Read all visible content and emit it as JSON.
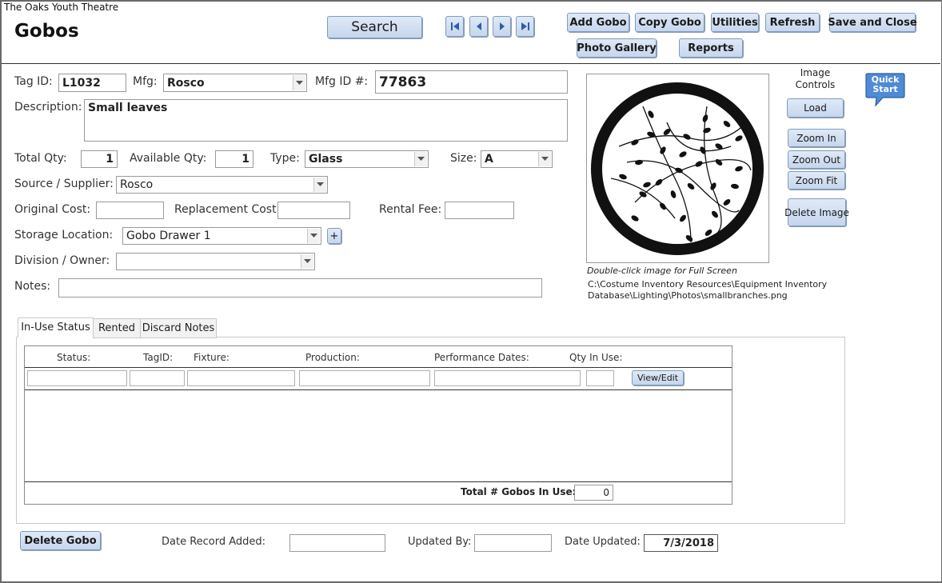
{
  "app": {
    "org_name": "The Oaks Youth Theatre",
    "form_title": "Gobos"
  },
  "toolbar": {
    "search": "Search",
    "add_gobo": "Add Gobo",
    "copy_gobo": "Copy Gobo",
    "utilities": "Utilities",
    "refresh": "Refresh",
    "save_close": "Save and Close",
    "photo_gallery": "Photo Gallery",
    "reports": "Reports"
  },
  "form": {
    "tag_id_label": "Tag ID:",
    "tag_id": "L1032",
    "mfg_label": "Mfg:",
    "mfg": "Rosco",
    "mfg_id_label": "Mfg ID #:",
    "mfg_id": "77863",
    "description_label": "Description:",
    "description": "Small leaves",
    "total_qty_label": "Total Qty:",
    "total_qty": "1",
    "available_qty_label": "Available Qty:",
    "available_qty": "1",
    "type_label": "Type:",
    "type": "Glass",
    "size_label": "Size:",
    "size": "A",
    "source_label": "Source / Supplier:",
    "source": "Rosco",
    "original_cost_label": "Original Cost:",
    "original_cost": "",
    "replacement_cost_label": "Replacement Cost:",
    "replacement_cost": "",
    "rental_fee_label": "Rental Fee:",
    "rental_fee": "",
    "storage_label": "Storage Location:",
    "storage": "Gobo Drawer 1",
    "storage_add": "+",
    "division_label": "Division / Owner:",
    "division": "",
    "notes_label": "Notes:",
    "notes": ""
  },
  "image": {
    "controls_label": "Image Controls",
    "load": "Load",
    "zoom_in": "Zoom In",
    "zoom_out": "Zoom Out",
    "zoom_fit": "Zoom Fit",
    "delete_image": "Delete Image",
    "hint": "Double-click image for Full Screen",
    "path_line1": "C:\\Costume Inventory Resources\\Equipment Inventory",
    "path_line2": "Database\\Lighting\\Photos\\smallbranches.png"
  },
  "quick_start": {
    "line1": "Quick",
    "line2": "Start"
  },
  "tabs": [
    "In-Use Status",
    "Rented",
    "Discard Notes"
  ],
  "subform": {
    "columns": [
      "Status:",
      "TagID:",
      "Fixture:",
      "Production:",
      "Performance Dates:",
      "Qty In Use:"
    ],
    "view_edit": "View/Edit",
    "total_label": "Total # Gobos In Use:",
    "total_value": "0"
  },
  "footer": {
    "delete_gobo": "Delete Gobo",
    "date_added_label": "Date Record Added:",
    "date_added": "",
    "updated_by_label": "Updated By:",
    "updated_by": "",
    "date_updated_label": "Date Updated:",
    "date_updated": "7/3/2018"
  },
  "colors": {
    "button_top": "#dfe9f7",
    "button_bottom": "#c6d6ee",
    "quick_start": "#3f7fd0"
  }
}
